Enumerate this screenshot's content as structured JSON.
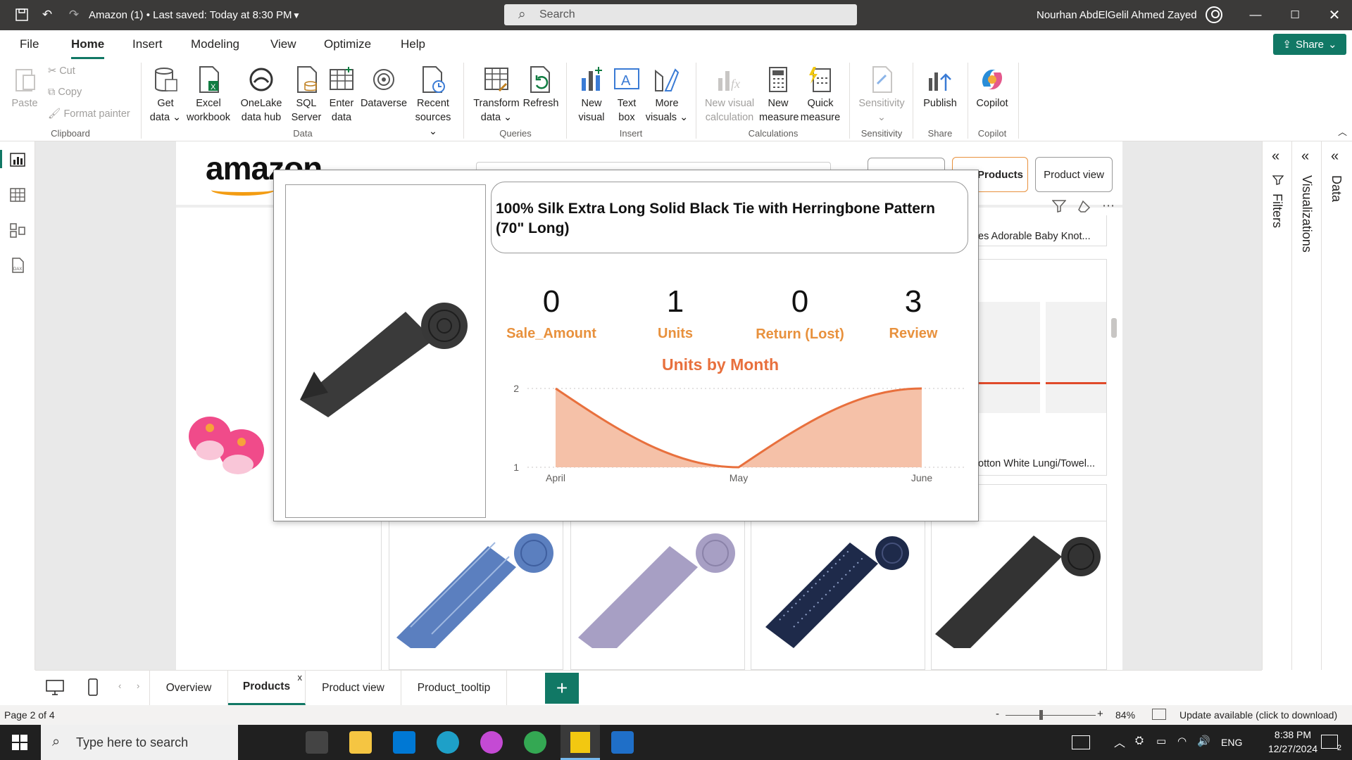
{
  "titlebar": {
    "doc_title": "Amazon (1) • Last saved: Today at 8:30 PM",
    "search_placeholder": "Search",
    "user_name": "Nourhan AbdElGelil Ahmed Zayed"
  },
  "menu": {
    "items": [
      "File",
      "Home",
      "Insert",
      "Modeling",
      "View",
      "Optimize",
      "Help"
    ],
    "share": "Share"
  },
  "ribbon": {
    "clipboard": {
      "paste": "Paste",
      "cut": "Cut",
      "copy": "Copy",
      "format_painter": "Format painter",
      "label": "Clipboard"
    },
    "data": {
      "get_data": "Get data",
      "excel": "Excel workbook",
      "onelake": "OneLake data hub",
      "sql": "SQL Server",
      "enter": "Enter data",
      "dataverse": "Dataverse",
      "recent": "Recent sources",
      "label": "Data"
    },
    "queries": {
      "transform": "Transform data",
      "refresh": "Refresh",
      "label": "Queries"
    },
    "insert": {
      "new_visual": "New visual",
      "text_box": "Text box",
      "more_visuals": "More visuals",
      "label": "Insert"
    },
    "calculations": {
      "new_visual_calc": "New visual calculation",
      "new_measure": "New measure",
      "quick_measure": "Quick measure",
      "label": "Calculations"
    },
    "sensitivity": {
      "btn": "Sensitivity",
      "label": "Sensitivity"
    },
    "share": {
      "publish": "Publish",
      "label": "Share"
    },
    "copilot": {
      "btn": "Copilot",
      "label": "Copilot"
    }
  },
  "report": {
    "logo": "amazon",
    "buttons": {
      "products": "Products",
      "product_view": "Product view"
    },
    "product_names": [
      "es Adorable Baby Knot...",
      "otton White Lungi/Towel..."
    ]
  },
  "tooltip": {
    "product_title": "100% Silk Extra Long Solid Black Tie with Herringbone Pattern (70\" Long)",
    "kpis": [
      {
        "value": "0",
        "label": "Sale_Amount"
      },
      {
        "value": "1",
        "label": "Units"
      },
      {
        "value": "0",
        "label": "Return (Lost)"
      },
      {
        "value": "3",
        "label": "Review"
      }
    ]
  },
  "chart_data": {
    "type": "area",
    "title": "Units by Month",
    "categories": [
      "April",
      "May",
      "June"
    ],
    "series": [
      {
        "values": [
          2,
          1,
          2
        ]
      }
    ],
    "ylim": [
      1,
      2
    ],
    "yticks": [
      "1",
      "2"
    ],
    "color": "#e8703d",
    "fill": "#f5c1a8"
  },
  "pages": {
    "tabs": [
      "Overview",
      "Products",
      "Product view",
      "Product_tooltip"
    ],
    "close_mark": "x"
  },
  "panes": {
    "filters": "Filters",
    "visualizations": "Visualizations",
    "data": "Data"
  },
  "status": {
    "page": "Page 2 of 4",
    "zoom": "84%",
    "update": "Update available (click to download)"
  },
  "taskbar": {
    "search": "Type here to search",
    "lang": "ENG",
    "time": "8:38 PM",
    "date": "12/27/2024",
    "notif_count": "2"
  }
}
